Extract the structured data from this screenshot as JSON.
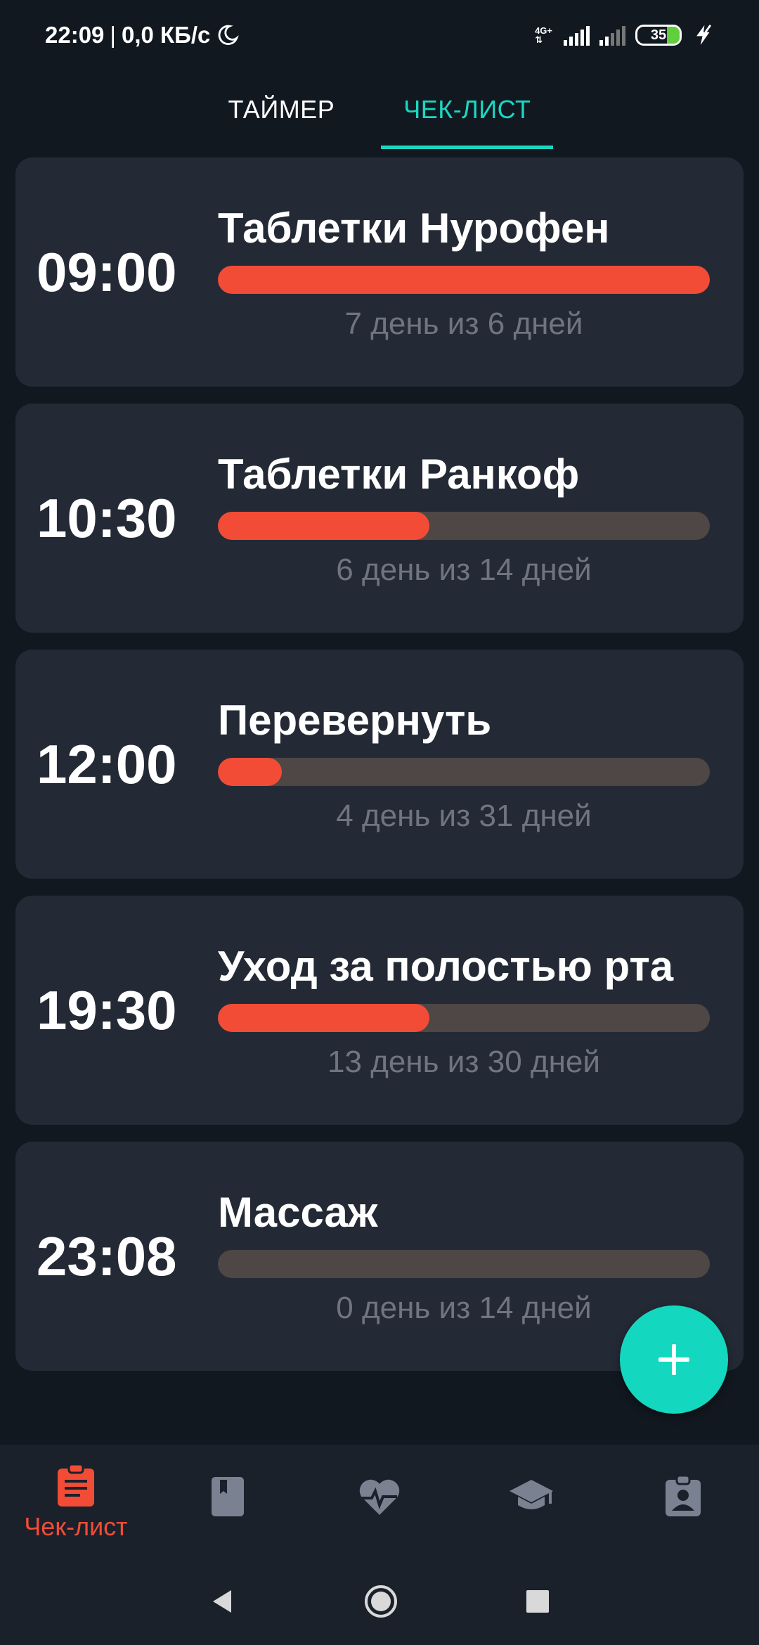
{
  "status_bar": {
    "time": "22:09",
    "separator": "|",
    "speed": "0,0 КБ/с",
    "network_type": "4G+",
    "battery": "35"
  },
  "tabs": [
    {
      "label": "ТАЙМЕР",
      "active": false
    },
    {
      "label": "ЧЕК-ЛИСТ",
      "active": true
    }
  ],
  "tasks": [
    {
      "time": "09:00",
      "title": "Таблетки Нурофен",
      "progress_text": "7 день из 6 дней",
      "progress": 1.0
    },
    {
      "time": "10:30",
      "title": "Таблетки Ранкоф",
      "progress_text": "6 день из 14 дней",
      "progress": 0.43
    },
    {
      "time": "12:00",
      "title": "Перевернуть",
      "progress_text": "4 день из 31 дней",
      "progress": 0.13
    },
    {
      "time": "19:30",
      "title": "Уход за полостью рта",
      "progress_text": "13 день из 30 дней",
      "progress": 0.43
    },
    {
      "time": "23:08",
      "title": "Массаж",
      "progress_text": "0 день из 14 дней",
      "progress": 0.0
    }
  ],
  "fab": {
    "icon": "plus-icon"
  },
  "bottom_nav": [
    {
      "icon": "clipboard-icon",
      "label": "Чек-лист",
      "active": true
    },
    {
      "icon": "book-icon",
      "label": "",
      "active": false
    },
    {
      "icon": "heart-pulse-icon",
      "label": "",
      "active": false
    },
    {
      "icon": "graduation-cap-icon",
      "label": "",
      "active": false
    },
    {
      "icon": "badge-icon",
      "label": "",
      "active": false
    }
  ],
  "colors": {
    "accent": "#19d8c2",
    "progress": "#f24c36",
    "card": "#242a35",
    "background": "#121820"
  }
}
